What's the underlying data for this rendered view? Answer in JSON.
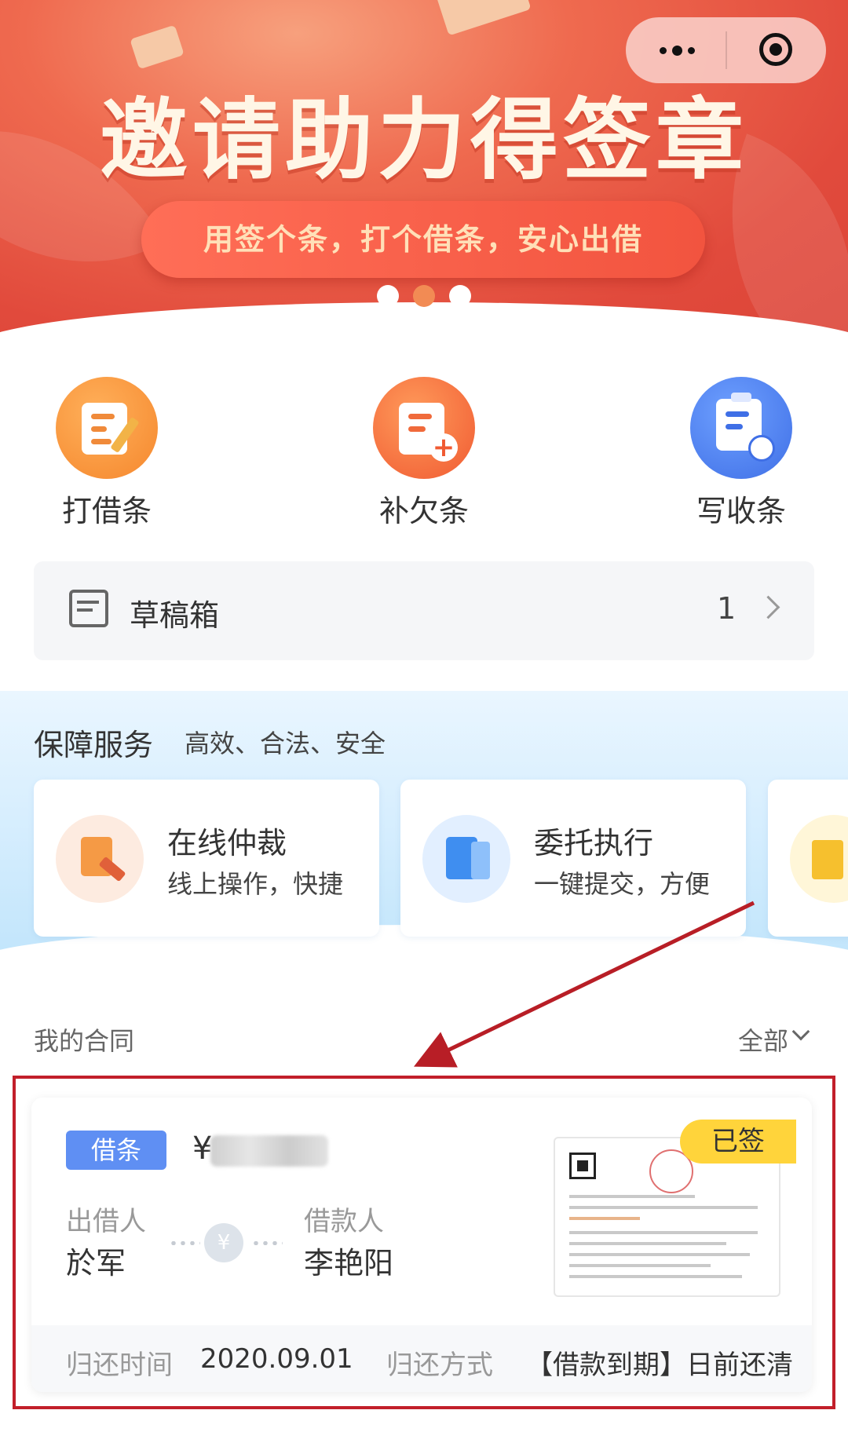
{
  "banner": {
    "title": "邀请助力得签章",
    "subtitle": "用签个条，打个借条，安心出借",
    "carousel_dots": 3,
    "active_dot": 1
  },
  "quick_actions": [
    {
      "label": "打借条",
      "icon": "write-iou-icon",
      "color": "#f5872d"
    },
    {
      "label": "补欠条",
      "icon": "add-debt-note-icon",
      "color": "#f46a3b"
    },
    {
      "label": "写收条",
      "icon": "receipt-clipboard-icon",
      "color": "#3f72e8"
    }
  ],
  "draft_box": {
    "label": "草稿箱",
    "count": "1"
  },
  "services": {
    "title": "保障服务",
    "subtitle": "高效、合法、安全",
    "items": [
      {
        "name": "在线仲裁",
        "desc": "线上操作，快捷",
        "icon": "arbitration-gavel-icon"
      },
      {
        "name": "委托执行",
        "desc": "一键提交，方便",
        "icon": "entrust-document-icon"
      }
    ]
  },
  "contracts": {
    "title": "我的合同",
    "filter": "全部",
    "card": {
      "tag": "借条",
      "currency": "¥",
      "status": "已签",
      "lender_label": "出借人",
      "lender_name": "於军",
      "borrower_label": "借款人",
      "borrower_name": "李艳阳",
      "return_time_label": "归还时间",
      "return_time": "2020.09.01",
      "return_method_label": "归还方式",
      "return_method": "【借款到期】日前还清"
    }
  },
  "colors": {
    "highlight_border": "#c21f2a",
    "tag": "#5f8ff3",
    "status_badge": "#ffd43b"
  }
}
